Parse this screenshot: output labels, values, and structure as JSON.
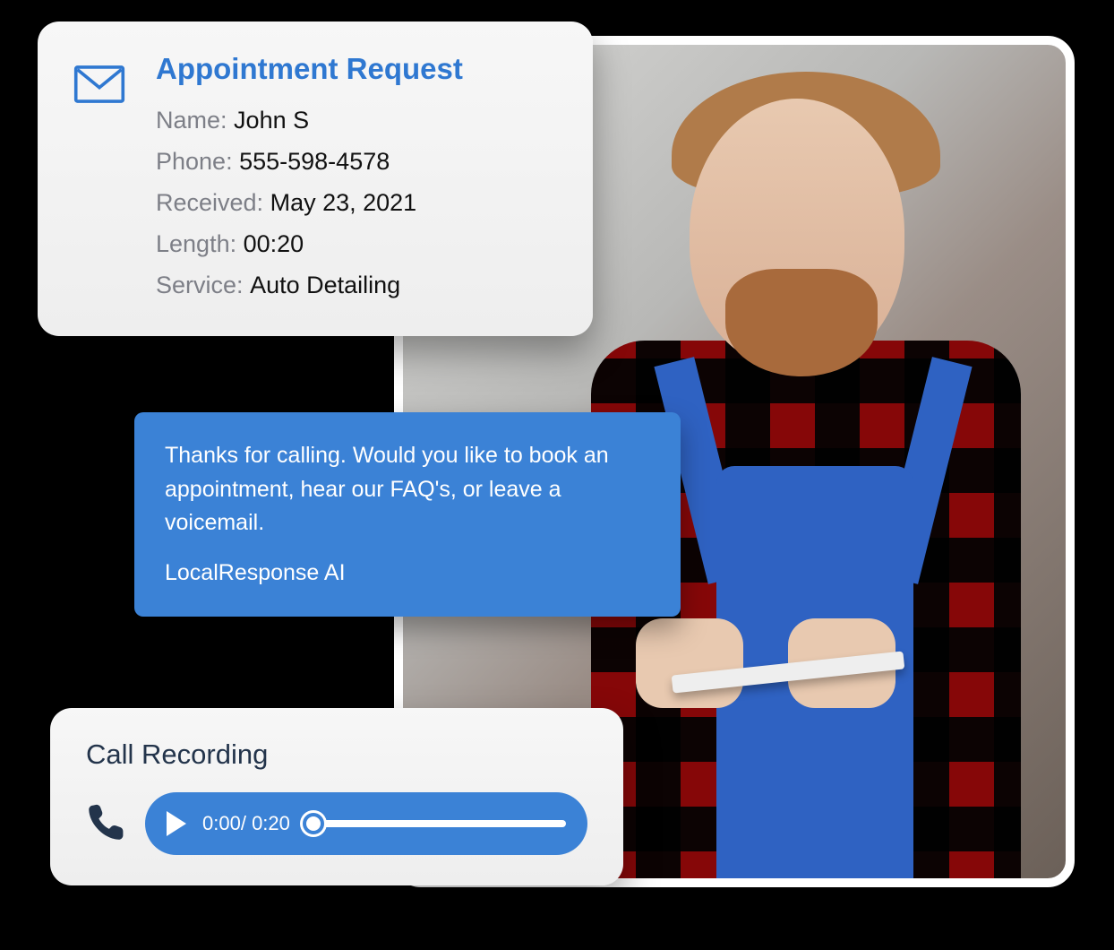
{
  "appointment": {
    "title": "Appointment Request",
    "fields": {
      "name_label": "Name:",
      "name": "John S",
      "phone_label": "Phone:",
      "phone": "555-598-4578",
      "received_label": "Received:",
      "received": "May 23, 2021",
      "length_label": "Length:",
      "length": "00:20",
      "service_label": "Service:",
      "service": "Auto Detailing"
    }
  },
  "ai_bubble": {
    "message": "Thanks for calling. Would you like to book an appointment, hear our FAQ's, or leave a voicemail.",
    "source": "LocalResponse AI"
  },
  "recording": {
    "title": "Call Recording",
    "current_time": "0:00",
    "duration": "0:20",
    "separator": "/ "
  },
  "colors": {
    "accent": "#3b82d6",
    "title_blue": "#2f78d1"
  }
}
